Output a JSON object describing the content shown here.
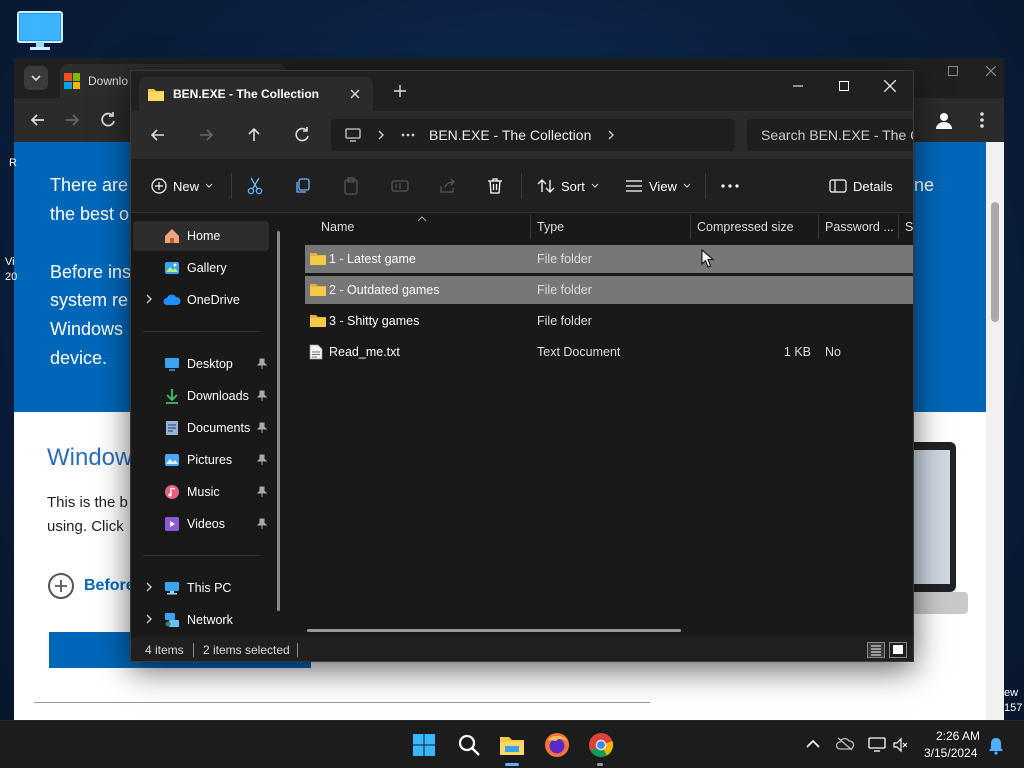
{
  "desktop": {
    "icon": "monitor-icon"
  },
  "browser": {
    "tab_title": "Downlo",
    "hero_lines": [
      "There are",
      "the best o",
      "Before ins",
      "system re",
      "Windows",
      "device."
    ],
    "hero_right": "ne",
    "heading": "Window",
    "body_lines": [
      "This is the b",
      "using. Click"
    ],
    "before_label": "Before",
    "left_edge": [
      "R",
      "Vi",
      "20"
    ],
    "right_edge": [
      "ew",
      "157"
    ]
  },
  "explorer": {
    "tab_title": "BEN.EXE - The Collection",
    "address": {
      "crumb": "BEN.EXE - The Collection"
    },
    "search": {
      "placeholder": "Search BEN.EXE - The Col"
    },
    "commands": {
      "new": "New",
      "sort": "Sort",
      "view": "View",
      "details": "Details"
    },
    "sidebar": {
      "home": "Home",
      "gallery": "Gallery",
      "onedrive": "OneDrive",
      "desktop": "Desktop",
      "downloads": "Downloads",
      "documents": "Documents",
      "pictures": "Pictures",
      "music": "Music",
      "videos": "Videos",
      "thispc": "This PC",
      "network": "Network"
    },
    "columns": {
      "name": "Name",
      "type": "Type",
      "compressed": "Compressed size",
      "password": "Password ...",
      "size": "Si"
    },
    "rows": [
      {
        "name": "1 - Latest game",
        "type": "File folder",
        "compressed": "",
        "password": "",
        "icon": "folder-icon",
        "selected": true
      },
      {
        "name": "2 - Outdated games",
        "type": "File folder",
        "compressed": "",
        "password": "",
        "icon": "folder-icon",
        "selected": true
      },
      {
        "name": "3 - Shitty games",
        "type": "File folder",
        "compressed": "",
        "password": "",
        "icon": "folder-icon",
        "selected": false
      },
      {
        "name": "Read_me.txt",
        "type": "Text Document",
        "compressed": "1 KB",
        "password": "No",
        "icon": "text-file-icon",
        "selected": false
      }
    ],
    "status": {
      "items": "4 items",
      "selected": "2 items selected"
    }
  },
  "taskbar": {
    "time": "2:26 AM",
    "date": "3/15/2024"
  },
  "colors": {
    "accent_blue": "#0067b8",
    "folder_yellow": "#f7c948",
    "selection_gray": "#777777"
  }
}
